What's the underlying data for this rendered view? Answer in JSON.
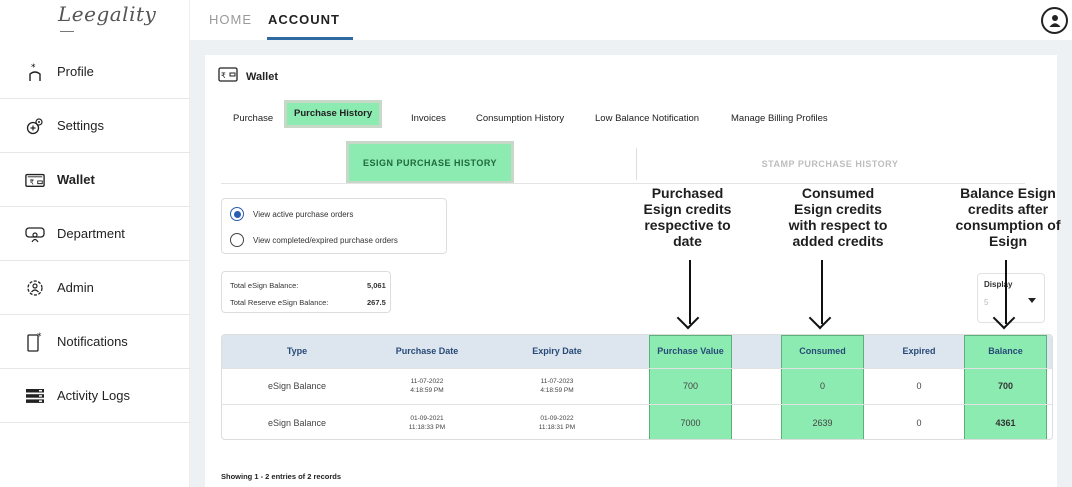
{
  "app": {
    "logo_text": "Leegality"
  },
  "topbar": {
    "tabs": [
      {
        "label": "HOME"
      },
      {
        "label": "ACCOUNT"
      }
    ],
    "active_tab": "ACCOUNT"
  },
  "sidebar": {
    "items": [
      {
        "label": "Profile",
        "icon": "profile-icon"
      },
      {
        "label": "Settings",
        "icon": "settings-icon"
      },
      {
        "label": "Wallet",
        "icon": "wallet-icon",
        "active": true
      },
      {
        "label": "Department",
        "icon": "department-icon"
      },
      {
        "label": "Admin",
        "icon": "admin-icon"
      },
      {
        "label": "Notifications",
        "icon": "notifications-icon"
      },
      {
        "label": "Activity Logs",
        "icon": "activity-logs-icon"
      }
    ]
  },
  "wallet": {
    "title": "Wallet",
    "subtabs": [
      {
        "label": "Purchase"
      },
      {
        "label": "Purchase History",
        "selected": true
      },
      {
        "label": "Invoices"
      },
      {
        "label": "Consumption History"
      },
      {
        "label": "Low Balance Notification"
      },
      {
        "label": "Manage Billing Profiles"
      }
    ],
    "section_tabs": [
      {
        "label": "ESIGN PURCHASE HISTORY",
        "selected": true
      },
      {
        "label": "STAMP PURCHASE HISTORY"
      }
    ],
    "filters": [
      {
        "label": "View active purchase orders",
        "checked": true
      },
      {
        "label": "View completed/expired purchase orders",
        "checked": false
      }
    ],
    "balances": [
      {
        "label": "Total eSign Balance:",
        "value": "5,061"
      },
      {
        "label": "Total Reserve eSign Balance:",
        "value": "267.5"
      }
    ],
    "display": {
      "label": "Display",
      "value": "5"
    },
    "annotations": [
      {
        "lines": [
          "Purchased",
          "Esign credits",
          "respective to",
          "date"
        ]
      },
      {
        "lines": [
          "Consumed",
          "Esign credits",
          "with respect to",
          "added credits"
        ]
      },
      {
        "lines": [
          "Balance Esign",
          "credits after",
          "consumption of",
          "Esign"
        ]
      }
    ],
    "table": {
      "headers": [
        "Type",
        "Purchase Date",
        "Expiry Date",
        "Purchase Value",
        "Consumed",
        "Expired",
        "Balance"
      ],
      "rows": [
        {
          "type": "eSign Balance",
          "purchase_date": "11-07-2022",
          "purchase_time": "4:18:59 PM",
          "expiry_date": "11-07-2023",
          "expiry_time": "4:18:59 PM",
          "purchase_value": "700",
          "consumed": "0",
          "expired": "0",
          "balance": "700"
        },
        {
          "type": "eSign Balance",
          "purchase_date": "01-09-2021",
          "purchase_time": "11:18:33 PM",
          "expiry_date": "01-09-2022",
          "expiry_time": "11:18:31 PM",
          "purchase_value": "7000",
          "consumed": "2639",
          "expired": "0",
          "balance": "4361"
        }
      ]
    },
    "footer": "Showing 1 - 2 entries of 2 records"
  },
  "colors": {
    "highlight": "#8cebb1",
    "accent": "#2f6aa1",
    "table_header": "#dde6ee"
  }
}
